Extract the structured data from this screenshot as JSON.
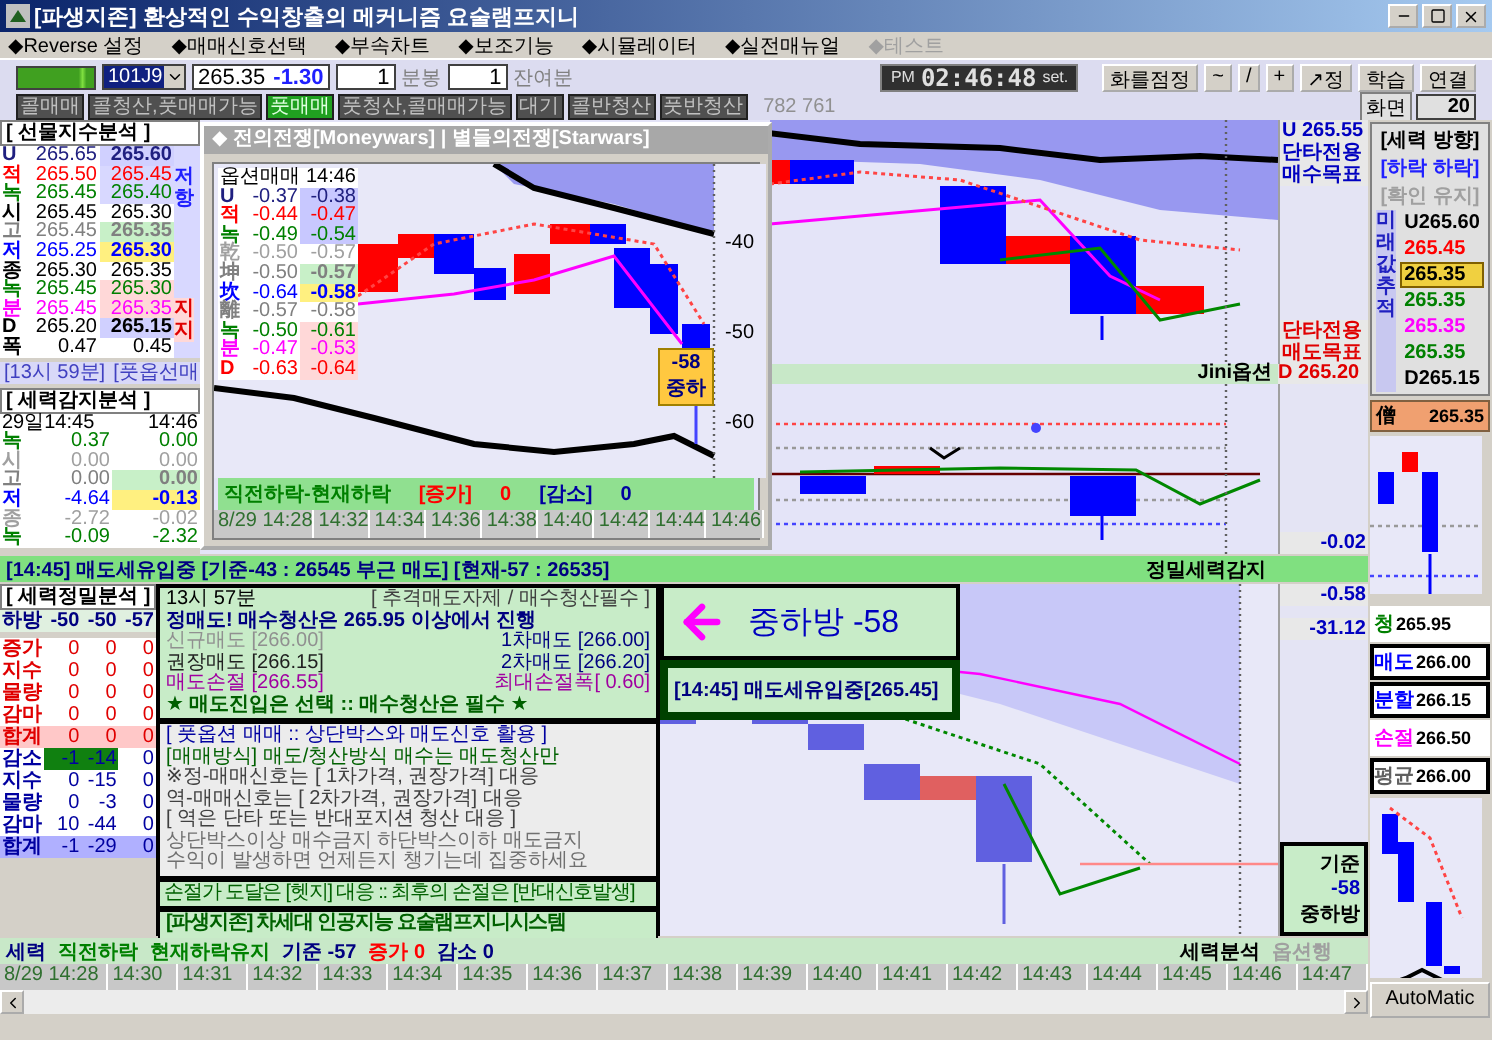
{
  "window": {
    "title": "[파생지존] 환상적인 수익창출의 메커니즘 요술램프지니"
  },
  "menu": [
    {
      "label": "◆Reverse 설정",
      "disabled": false
    },
    {
      "label": "◆매매신호선택",
      "disabled": false
    },
    {
      "label": "◆부속차트",
      "disabled": false
    },
    {
      "label": "◆보조기능",
      "disabled": false
    },
    {
      "label": "◆시뮬레이터",
      "disabled": false
    },
    {
      "label": "◆실전매뉴얼",
      "disabled": false
    },
    {
      "label": "◆테스트",
      "disabled": true
    }
  ],
  "toolbar": {
    "symbol": "101J9",
    "price": "265.35",
    "change": "-1.30",
    "interval": "1",
    "interval_unit": "분봉",
    "remaining": "1",
    "remaining_unit": "잔여분"
  },
  "clock": {
    "period": "PM",
    "time": "02:46:48",
    "mode": "set."
  },
  "tool_buttons": [
    "화를점정",
    "~",
    "/",
    "+",
    "↗정",
    "학습",
    "연결"
  ],
  "signal_chips": [
    {
      "label": "콜매매",
      "active": false
    },
    {
      "label": "콜청산,풋매매가능",
      "active": false
    },
    {
      "label": "풋매매",
      "active": true
    },
    {
      "label": "풋청산,콜매매가능",
      "active": false
    },
    {
      "label": "대기",
      "active": false
    },
    {
      "label": "콜반청산",
      "active": false
    },
    {
      "label": "풋반청산",
      "active": false
    }
  ],
  "signal_counts": "782 761",
  "screen": {
    "label": "화면",
    "value": "20"
  },
  "futures_panel": {
    "title": "[ 선물지수분석 ]",
    "resist_label": "저항",
    "support_label": "지지",
    "rows": [
      {
        "label": "U",
        "a": "265.65",
        "b": "265.60",
        "color": "#202080",
        "kind": "boxed"
      },
      {
        "label": "적",
        "a": "265.50",
        "b": "265.45",
        "color": "#ff0000",
        "kind": "resist"
      },
      {
        "label": "녹",
        "a": "265.45",
        "b": "265.40",
        "color": "#008000",
        "kind": "resist"
      },
      {
        "label": "시",
        "a": "265.45",
        "b": "265.30",
        "color": "#000000",
        "kind": "plain"
      },
      {
        "label": "고",
        "a": "265.45",
        "b": "265.35",
        "color": "#808080",
        "kind": "green"
      },
      {
        "label": "저",
        "a": "265.25",
        "b": "265.30",
        "color": "#0000ff",
        "kind": "yellow"
      },
      {
        "label": "종",
        "a": "265.30",
        "b": "265.35",
        "color": "#000000",
        "kind": "plain"
      },
      {
        "label": "녹",
        "a": "265.45",
        "b": "265.30",
        "color": "#008000",
        "kind": "support"
      },
      {
        "label": "분",
        "a": "265.45",
        "b": "265.35",
        "color": "#ff00ff",
        "kind": "support"
      },
      {
        "label": "D",
        "a": "265.20",
        "b": "265.15",
        "color": "#000000",
        "kind": "boxed"
      },
      {
        "label": "폭",
        "a": "0.47",
        "b": "0.45",
        "color": "#000000",
        "kind": "plain"
      }
    ],
    "footer": [
      "[13시 59분]",
      "[풋옵선매"
    ]
  },
  "force_panel": {
    "title": "[ 세력감지분석 ]",
    "header": [
      "29일14:45",
      "14:46"
    ],
    "rows": [
      {
        "label": "녹",
        "a": "0.37",
        "b": "0.00",
        "color": "#008000",
        "kind": "plain"
      },
      {
        "label": "시",
        "a": "0.00",
        "b": "0.00",
        "color": "#a0a0a0",
        "kind": "plain"
      },
      {
        "label": "고",
        "a": "0.00",
        "b": "0.00",
        "color": "#808080",
        "kind": "green"
      },
      {
        "label": "저",
        "a": "-4.64",
        "b": "-0.13",
        "color": "#0000ff",
        "kind": "yellow"
      },
      {
        "label": "종",
        "a": "-2.72",
        "b": "-0.02",
        "color": "#a0a0a0",
        "kind": "plain"
      },
      {
        "label": "녹",
        "a": "-0.09",
        "b": "-2.32",
        "color": "#008000",
        "kind": "plain"
      }
    ]
  },
  "popup": {
    "title": "◆ 전의전쟁[Moneywars] | 별들의전쟁[Starwars]",
    "table_header": [
      "옵션매매",
      "14:46"
    ],
    "rows": [
      {
        "label": "U",
        "a": "-0.37",
        "b": "-0.38",
        "color": "#202080",
        "kind": "blue"
      },
      {
        "label": "적",
        "a": "-0.44",
        "b": "-0.47",
        "color": "#ff0000",
        "kind": "blue"
      },
      {
        "label": "녹",
        "a": "-0.49",
        "b": "-0.54",
        "color": "#008000",
        "kind": "blue"
      },
      {
        "label": "乾",
        "a": "-0.50",
        "b": "-0.57",
        "color": "#a0a0a0",
        "kind": "plain"
      },
      {
        "label": "坤",
        "a": "-0.50",
        "b": "-0.57",
        "color": "#808080",
        "kind": "green"
      },
      {
        "label": "坎",
        "a": "-0.64",
        "b": "-0.58",
        "color": "#0000ff",
        "kind": "yellow"
      },
      {
        "label": "離",
        "a": "-0.57",
        "b": "-0.58",
        "color": "#808080",
        "kind": "plain"
      },
      {
        "label": "녹",
        "a": "-0.50",
        "b": "-0.61",
        "color": "#008000",
        "kind": "pink"
      },
      {
        "label": "분",
        "a": "-0.47",
        "b": "-0.53",
        "color": "#ff00ff",
        "kind": "pink"
      },
      {
        "label": "D",
        "a": "-0.63",
        "b": "-0.64",
        "color": "#ff0000",
        "kind": "pink"
      }
    ],
    "yticks": [
      "-40",
      "-50",
      "-60"
    ],
    "badge": {
      "value": "-58",
      "label": "중하"
    },
    "summary": [
      {
        "text": "직전하락-현재하락",
        "color": "#008000"
      },
      {
        "text": "[증가]",
        "color": "#ff0000"
      },
      {
        "text": "0",
        "color": "#ff0000"
      },
      {
        "text": "[감소]",
        "color": "#0000a0"
      },
      {
        "text": "0",
        "color": "#0000a0"
      }
    ],
    "time_axis": [
      "8/29 14:28",
      "14:32",
      "14:34",
      "14:36",
      "14:38",
      "14:40",
      "14:42",
      "14:44",
      "14:46"
    ]
  },
  "main_chart": {
    "upper_labels": [
      "U 265.55",
      "단타전용",
      "매수목표"
    ],
    "lower_labels": [
      "단타전용",
      "매도목표"
    ],
    "strip_label": "Jini옵션",
    "strip_value": "D 265.20",
    "lower_value": "-0.02"
  },
  "direction_panel": {
    "title": "[세력 방향]",
    "direction": "[하락 하락]",
    "confirm": "[확인 유지]",
    "track_label": "미래값추적",
    "values": [
      {
        "text": "U265.60",
        "color": "#000000",
        "highlighted": false
      },
      {
        "text": "265.45",
        "color": "#ff0000",
        "highlighted": false
      },
      {
        "text": "265.35",
        "highlighted": true
      },
      {
        "text": "265.35",
        "color": "#008000",
        "highlighted": false
      },
      {
        "text": "265.35",
        "color": "#ff00ff",
        "highlighted": false
      },
      {
        "text": "265.35",
        "color": "#008000",
        "highlighted": false
      },
      {
        "text": "D265.15",
        "color": "#000000",
        "highlighted": false
      }
    ],
    "total_mark": "僧",
    "total_value": "265.35"
  },
  "alert_bar": {
    "message": "[14:45] 매도세유입중 [기준-43 : 26545 부근 매도] [현재-57 : 26535]",
    "label": "정밀세력감지"
  },
  "detail_panel": {
    "title": "[ 세력정밀분석 ]",
    "header": [
      "하방",
      "-50",
      "-50",
      "-57"
    ],
    "rows": [
      {
        "label": "증가",
        "values": [
          "0",
          "0",
          "0"
        ],
        "kind": "up"
      },
      {
        "label": "지수",
        "values": [
          "0",
          "0",
          "0"
        ],
        "kind": "up"
      },
      {
        "label": "물량",
        "values": [
          "0",
          "0",
          "0"
        ],
        "kind": "up"
      },
      {
        "label": "감마",
        "values": [
          "0",
          "0",
          "0"
        ],
        "kind": "up"
      },
      {
        "label": "합계",
        "values": [
          "0",
          "0",
          "0"
        ],
        "kind": "up_total"
      },
      {
        "label": "감소",
        "values": [
          "-1",
          "-14",
          "0"
        ],
        "kind": "down_mark"
      },
      {
        "label": "지수",
        "values": [
          "0",
          "-15",
          "0"
        ],
        "kind": "down"
      },
      {
        "label": "물량",
        "values": [
          "0",
          "-3",
          "0"
        ],
        "kind": "down"
      },
      {
        "label": "감마",
        "values": [
          "10",
          "-44",
          "0"
        ],
        "kind": "down"
      },
      {
        "label": "합계",
        "values": [
          "-1",
          "-29",
          "0"
        ],
        "kind": "down_total"
      }
    ]
  },
  "strategy": {
    "time": "13시 57분",
    "headline": "[ 추격매도자제 / 매수청산필수 ]",
    "lead": "정매도! 매수청산은 265.95 이상에서 진행",
    "orders": [
      [
        {
          "text": "신규매도 [266.00]",
          "color": "#909090"
        },
        {
          "text": "1차매도 [266.00]",
          "color": "#000080"
        }
      ],
      [
        {
          "text": "권장매도 [266.15]",
          "color": "#202020"
        },
        {
          "text": "2차매도 [266.20]",
          "color": "#000080"
        }
      ],
      [
        {
          "text": "매도손절 [266.55]",
          "color": "#a000a0"
        },
        {
          "text": "최대손절폭[ 0.60]",
          "color": "#a000a0"
        }
      ]
    ],
    "rule": "★ 매도진입은 선택 :: 매수청산은 필수 ★"
  },
  "guide": [
    {
      "text": "[ 풋옵션 매매 :: 상단박스와 매도신호 활용 ]",
      "color": "#0000a0"
    },
    {
      "text": "[매매방식] 매도/청산방식 매수는 매도청산만",
      "color": "#006000"
    },
    {
      "text": "※정-매매신호는 [ 1차가격, 권장가격] 대응",
      "color": "#404040"
    },
    {
      "text": "역-매매신호는 [ 2차가격, 권장가격] 대응",
      "color": "#404040"
    },
    {
      "text": "[ 역은 단타 또는 반대포지션 청산 대응 ]",
      "color": "#404040"
    },
    {
      "text": "상단박스이상 매수금지  하단박스이하 매도금지",
      "color": "#707070"
    },
    {
      "text": "수익이 발생하면 언제든지 챙기는데 집중하세요",
      "color": "#707070"
    }
  ],
  "note": "손절가 도달은 [헷지] 대응 :: 최후의 손절은 [반대신호발생]",
  "brand": "[파생지존] 차세대 인공지능 요술램프지니시스템",
  "callout": {
    "label": "중하방 -58",
    "message": "[14:45] 매도세유입중[265.45]"
  },
  "lower_chart": {
    "values": [
      "-0.58",
      "-31.12"
    ],
    "base_box": [
      "기준",
      "-58",
      "중하방"
    ]
  },
  "order_panel": [
    {
      "label": "청",
      "value": "265.95",
      "color": "#008000",
      "boxed": false
    },
    {
      "label": "매도",
      "value": "266.00",
      "color": "#0000ff",
      "boxed": true
    },
    {
      "label": "분할",
      "value": "266.15",
      "color": "#0000ff",
      "boxed": true
    },
    {
      "label": "손절",
      "value": "266.50",
      "color": "#ff00ff",
      "boxed": false
    },
    {
      "label": "평균",
      "value": "266.00",
      "color": "#606060",
      "boxed": true
    }
  ],
  "bottom_bar": {
    "items": [
      {
        "text": "세력",
        "color": "#000080"
      },
      {
        "text": "직전하락",
        "color": "#008000"
      },
      {
        "text": "현재하락유지",
        "color": "#008000"
      },
      {
        "text": "기준 -57",
        "color": "#000080"
      },
      {
        "text": "증가 0",
        "color": "#ff0000"
      },
      {
        "text": "감소 0",
        "color": "#000080"
      }
    ],
    "right": [
      "세력분석",
      "옵션행"
    ]
  },
  "time_axis": [
    "8/29 14:28",
    "14:30",
    "14:31",
    "14:32",
    "14:33",
    "14:34",
    "14:35",
    "14:36",
    "14:37",
    "14:38",
    "14:39",
    "14:40",
    "14:41",
    "14:42",
    "14:43",
    "14:44",
    "14:45",
    "14:46",
    "14:47"
  ],
  "automatic": "AutoMatic"
}
